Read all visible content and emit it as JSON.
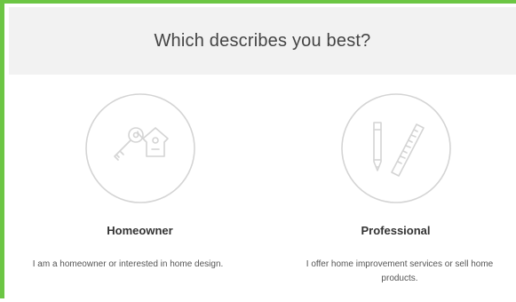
{
  "header": {
    "title": "Which describes you best?"
  },
  "options": [
    {
      "title": "Homeowner",
      "description": "I am a homeowner or interested in home design.",
      "icon": "keys-house-tag-icon"
    },
    {
      "title": "Professional",
      "description": "I offer home improvement services or sell home products.",
      "icon": "pencil-ruler-icon"
    }
  ],
  "colors": {
    "accent_border": "#6cc644",
    "header_bg": "#f2f2f2",
    "icon_stroke": "#d6d6d6"
  }
}
